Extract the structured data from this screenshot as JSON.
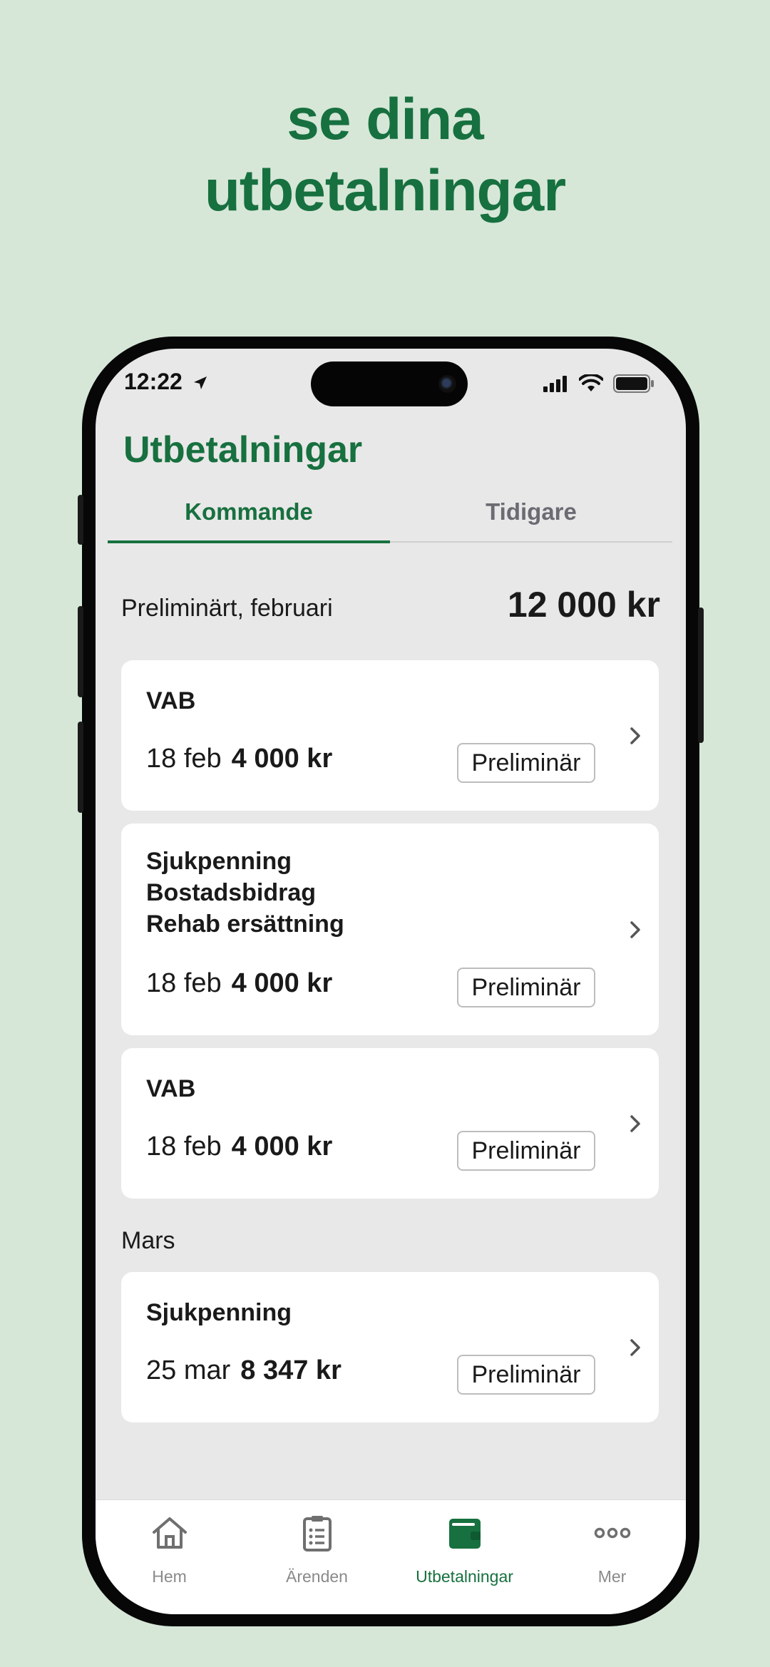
{
  "headline": {
    "line1": "se dina",
    "line2": "utbetalningar"
  },
  "status_bar": {
    "time": "12:22",
    "icons": [
      "location-arrow-icon",
      "cellular-signal-icon",
      "wifi-icon",
      "battery-icon"
    ]
  },
  "page": {
    "title": "Utbetalningar"
  },
  "tabs": [
    {
      "label": "Kommande",
      "active": true
    },
    {
      "label": "Tidigare",
      "active": false
    }
  ],
  "summary": {
    "label": "Preliminärt, februari",
    "total": "12 000 kr"
  },
  "february_payments": [
    {
      "titles": [
        "VAB"
      ],
      "date": "18 feb",
      "amount": "4 000 kr",
      "status": "Preliminär"
    },
    {
      "titles": [
        "Sjukpenning",
        "Bostadsbidrag",
        "Rehab ersättning"
      ],
      "date": "18 feb",
      "amount": "4 000 kr",
      "status": "Preliminär"
    },
    {
      "titles": [
        "VAB"
      ],
      "date": "18 feb",
      "amount": "4 000 kr",
      "status": "Preliminär"
    }
  ],
  "march": {
    "label": "Mars",
    "payments": [
      {
        "titles": [
          "Sjukpenning"
        ],
        "date": "25 mar",
        "amount": "8 347 kr",
        "status": "Preliminär"
      }
    ]
  },
  "tabbar": [
    {
      "label": "Hem",
      "icon": "home-icon",
      "active": false
    },
    {
      "label": "Ärenden",
      "icon": "clipboard-icon",
      "active": false
    },
    {
      "label": "Utbetalningar",
      "icon": "wallet-icon",
      "active": true
    },
    {
      "label": "Mer",
      "icon": "more-dots-icon",
      "active": false
    }
  ],
  "colors": {
    "brand_green": "#17703f",
    "background": "#d6e7d8",
    "screen": "#e9e8e8"
  }
}
